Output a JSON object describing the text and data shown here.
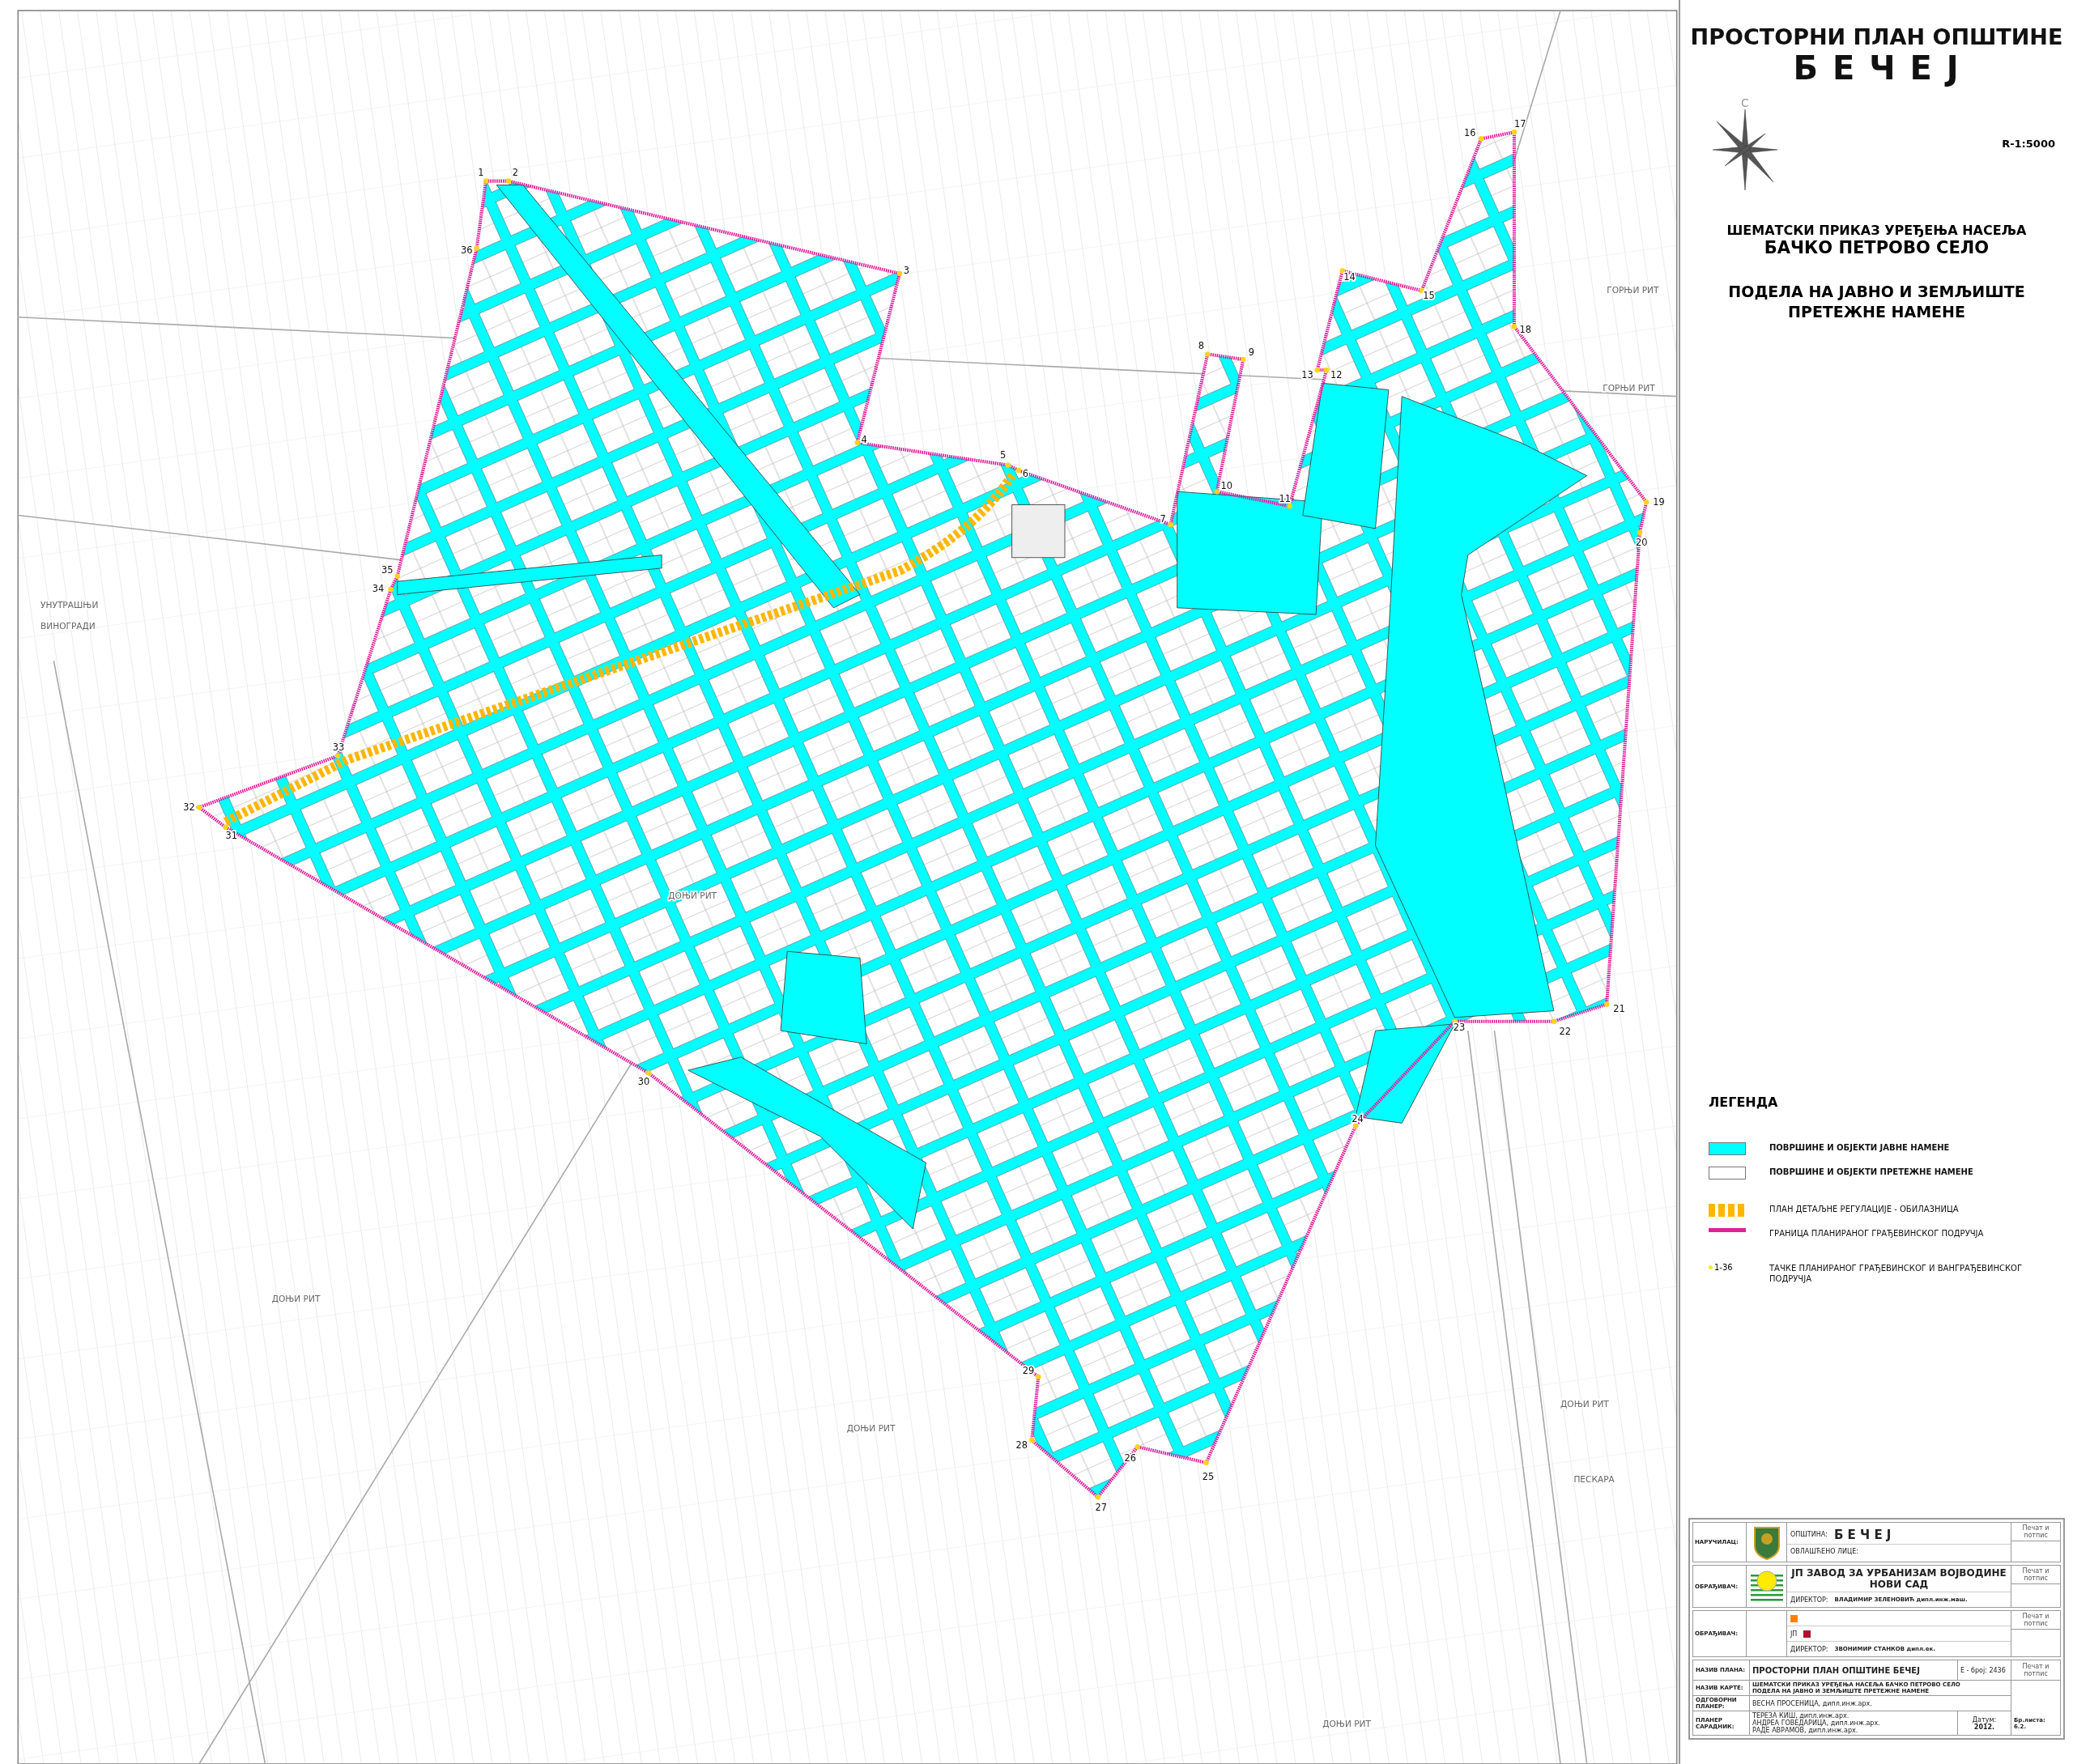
{
  "map": {
    "points": [
      {
        "label": "1"
      },
      {
        "label": "2"
      },
      {
        "label": "3"
      },
      {
        "label": "4"
      },
      {
        "label": "5"
      },
      {
        "label": "6"
      },
      {
        "label": "7"
      },
      {
        "label": "8"
      },
      {
        "label": "9"
      },
      {
        "label": "10"
      },
      {
        "label": "11"
      },
      {
        "label": "12"
      },
      {
        "label": "13"
      },
      {
        "label": "14"
      },
      {
        "label": "15"
      },
      {
        "label": "16"
      },
      {
        "label": "17"
      },
      {
        "label": "18"
      },
      {
        "label": "19"
      },
      {
        "label": "20"
      },
      {
        "label": "21"
      },
      {
        "label": "22"
      },
      {
        "label": "23"
      },
      {
        "label": "24"
      },
      {
        "label": "25"
      },
      {
        "label": "26"
      },
      {
        "label": "27"
      },
      {
        "label": "28"
      },
      {
        "label": "29"
      },
      {
        "label": "30"
      },
      {
        "label": "31"
      },
      {
        "label": "32"
      },
      {
        "label": "33"
      },
      {
        "label": "34"
      },
      {
        "label": "35"
      },
      {
        "label": "36"
      }
    ],
    "place_labels": [
      "ДОЊИ РИТ",
      "ДОЊИ РИТ",
      "ДОЊИ РИТ",
      "ДОЊИ РИТ",
      "ДОЊИ РИТ",
      "ГОРЊИ РИТ",
      "ГОРЊИ РИТ",
      "ПЕСКАРА",
      "УНУТРАШЊИ",
      "ВИНОГРАДИ"
    ]
  },
  "title": {
    "line1": "ПРОСТОРНИ ПЛАН ОПШТИНЕ",
    "line2": "Б Е Ч Е Ј",
    "north_label": "С",
    "scale": "R-1:5000",
    "subtitle1": "ШЕМАТСКИ ПРИКАЗ УРЕЂЕЊА НАСЕЉА",
    "subtitle2": "БАЧКО ПЕТРОВО СЕЛО",
    "subtitle3": "ПОДЕЛА НА ЈАВНО И ЗЕМЉИШТЕ",
    "subtitle4": "ПРЕТЕЖНЕ НАМЕНЕ"
  },
  "legend": {
    "title": "ЛЕГЕНДА",
    "items": [
      {
        "kind": "public",
        "label": "ПОВРШИНЕ И ОБЈЕКТИ ЈАВНЕ НАМЕНЕ"
      },
      {
        "kind": "other",
        "label": "ПОВРШИНЕ И ОБЈЕКТИ ПРЕТЕЖНЕ НАМЕНЕ"
      },
      {
        "kind": "bypass",
        "label": "ПЛАН ДЕТАЉНЕ РЕГУЛАЦИЈЕ - ОБИЛАЗНИЦА"
      },
      {
        "kind": "boundary",
        "label": "ГРАНИЦА ПЛАНИРАНОГ ГРАЂЕВИНСКОГ ПОДРУЧЈА"
      },
      {
        "kind": "points",
        "symbol": "1-36",
        "label": "ТАЧКЕ ПЛАНИРАНОГ ГРАЂЕВИНСКОГ И ВАНГРАЂЕВИНСКОГ ПОДРУЧЈА"
      }
    ]
  },
  "title_block": {
    "client_label": "НАРУЧИЛАЦ:",
    "municipality_label": "ОПШТИНА:",
    "municipality": "Б Е Ч Е Ј",
    "authorized_label": "ОВЛАШЋЕНО ЛИЦЕ:",
    "maker_label": "ОБРАЂИВАЧ:",
    "institute_line1": "ЈП ЗАВОД ЗА УРБАНИЗАМ ВОЈВОДИНЕ",
    "institute_line2": "НОВИ САД",
    "director_label": "ДИРЕКТОР:",
    "director": "ВЛАДИМИР ЗЕЛЕНОВИЋ дипл.инж.маш.",
    "maker2_label": "ОБРАЂИВАЧ:",
    "maker2_prefix": "ЈП",
    "director2_label": "ДИРЕКТОР:",
    "director2": "ЗВОНИМИР СТАНКОВ дипл.ек.",
    "stamp_labels": [
      "Печат и потпис",
      "Печат и потпис",
      "Печат и потпис",
      "Печат и потпис"
    ],
    "plan_label": "НАЗИВ ПЛАНА:",
    "plan_name": "ПРОСТОРНИ ПЛАН ОПШТИНЕ БЕЧЕЈ",
    "plan_number": "Е - број: 2436",
    "map_label": "НАЗИВ КАРТЕ:",
    "map_name1": "ШЕМАТСКИ ПРИКАЗ УРЕЂЕЊА НАСЕЉА БАЧКО ПЕТРОВО СЕЛО",
    "map_name2": "ПОДЕЛА НА ЈАВНО И ЗЕМЉИШТЕ ПРЕТЕЖНЕ НАМЕНЕ",
    "lead_label": "ОДГОВОРНИ ПЛАНЕР:",
    "lead": "ВЕСНА ПРОСЕНИЦА, дипл.инж.арх.",
    "assoc_label": "ПЛАНЕР САРАДНИК:",
    "assoc": [
      "ТЕРЕЗА КИШ, дипл.инж.арх.",
      "АНДРЕА ГОВЕДАРИЦА, дипл.инж.арх.",
      "РАДЕ АВРАМОВ, дипл.инж.арх."
    ],
    "date_label": "Датум:",
    "date": "2012.",
    "sheet": "Бр.листа: 6.2."
  }
}
